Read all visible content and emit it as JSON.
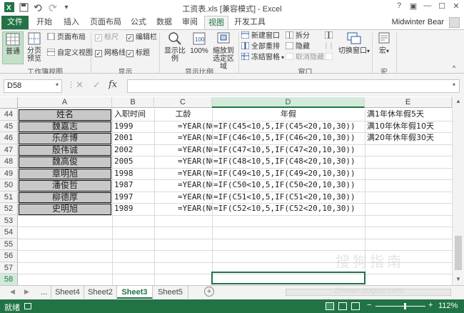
{
  "window": {
    "title": "工资表.xls  [兼容模式] - Excel",
    "controls": [
      "?",
      "▣",
      "—",
      "☐",
      "✕"
    ]
  },
  "tabs": [
    "文件",
    "开始",
    "插入",
    "页面布局",
    "公式",
    "数据",
    "审阅",
    "视图",
    "开发工具"
  ],
  "active_tab": "视图",
  "user": "Midwinter Bear",
  "ribbon": {
    "workbook_views": {
      "label": "工作簿视图",
      "normal": "普通",
      "page_break": "分页\n预览",
      "page_layout": "页面布局",
      "custom_views": "自定义视图"
    },
    "show": {
      "label": "显示",
      "ruler": "标尺",
      "gridlines": "网格线",
      "formula_bar": "编辑栏",
      "headings": "标题"
    },
    "zoom": {
      "label": "显示比例",
      "zoom": "显示比例",
      "hundred": "100%",
      "zoom_selection": "缩放到\n选定区域"
    },
    "window": {
      "label": "窗口",
      "new_window": "新建窗口",
      "arrange_all": "全部重排",
      "freeze_panes": "冻结窗格",
      "split": "拆分",
      "hide": "隐藏",
      "unhide": "取消隐藏",
      "switch_windows": "切换窗口"
    },
    "macros": {
      "label": "宏",
      "macros": "宏"
    }
  },
  "formula_bar": {
    "name_box": "D58",
    "value": ""
  },
  "columns": [
    "A",
    "B",
    "C",
    "D",
    "E"
  ],
  "rows": [
    {
      "num": "44",
      "a": "姓名",
      "b": "入职时间",
      "c": "工龄",
      "d": "年假",
      "e": "满1年休年假5天"
    },
    {
      "num": "45",
      "a": "魏嘉志",
      "b": "1999",
      "c": "=YEAR(NOW())",
      "d": "=IF(C45<10,5,IF(C45<20,10,30))",
      "e": "满10年休年假10天"
    },
    {
      "num": "46",
      "a": "乐彦博",
      "b": "2001",
      "c": "=YEAR(NOW())",
      "d": "=IF(C46<10,5,IF(C46<20,10,30))",
      "e": "满20年休年假30天"
    },
    {
      "num": "47",
      "a": "殷伟诚",
      "b": "2002",
      "c": "=YEAR(NOW())",
      "d": "=IF(C47<10,5,IF(C47<20,10,30))",
      "e": ""
    },
    {
      "num": "48",
      "a": "魏高俊",
      "b": "2005",
      "c": "=YEAR(NOW())",
      "d": "=IF(C48<10,5,IF(C48<20,10,30))",
      "e": ""
    },
    {
      "num": "49",
      "a": "章明旭",
      "b": "1998",
      "c": "=YEAR(NOW())",
      "d": "=IF(C49<10,5,IF(C49<20,10,30))",
      "e": ""
    },
    {
      "num": "50",
      "a": "潘俊哲",
      "b": "1987",
      "c": "=YEAR(NOW())",
      "d": "=IF(C50<10,5,IF(C50<20,10,30))",
      "e": ""
    },
    {
      "num": "51",
      "a": "柳德厚",
      "b": "1997",
      "c": "=YEAR(NOW())",
      "d": "=IF(C51<10,5,IF(C51<20,10,30))",
      "e": ""
    },
    {
      "num": "52",
      "a": "史明旭",
      "b": "1989",
      "c": "=YEAR(NOW())",
      "d": "=IF(C52<10,5,IF(C52<20,10,30))",
      "e": ""
    },
    {
      "num": "53",
      "a": "",
      "b": "",
      "c": "",
      "d": "",
      "e": ""
    },
    {
      "num": "54",
      "a": "",
      "b": "",
      "c": "",
      "d": "",
      "e": ""
    },
    {
      "num": "55",
      "a": "",
      "b": "",
      "c": "",
      "d": "",
      "e": ""
    },
    {
      "num": "56",
      "a": "",
      "b": "",
      "c": "",
      "d": "",
      "e": ""
    },
    {
      "num": "57",
      "a": "",
      "b": "",
      "c": "",
      "d": "",
      "e": ""
    },
    {
      "num": "58",
      "a": "",
      "b": "",
      "c": "",
      "d": "",
      "e": ""
    }
  ],
  "sheets": [
    "...",
    "Sheet4",
    "Sheet2",
    "Sheet3",
    "Sheet5"
  ],
  "active_sheet": "Sheet3",
  "status": {
    "ready": "就绪",
    "zoom": "112%"
  },
  "watermark": "搜狗指南",
  "watermark_url": "zhinan.sogou.com",
  "colors": {
    "accent": "#217346",
    "name_cell_fill": "#c8c8c8"
  }
}
